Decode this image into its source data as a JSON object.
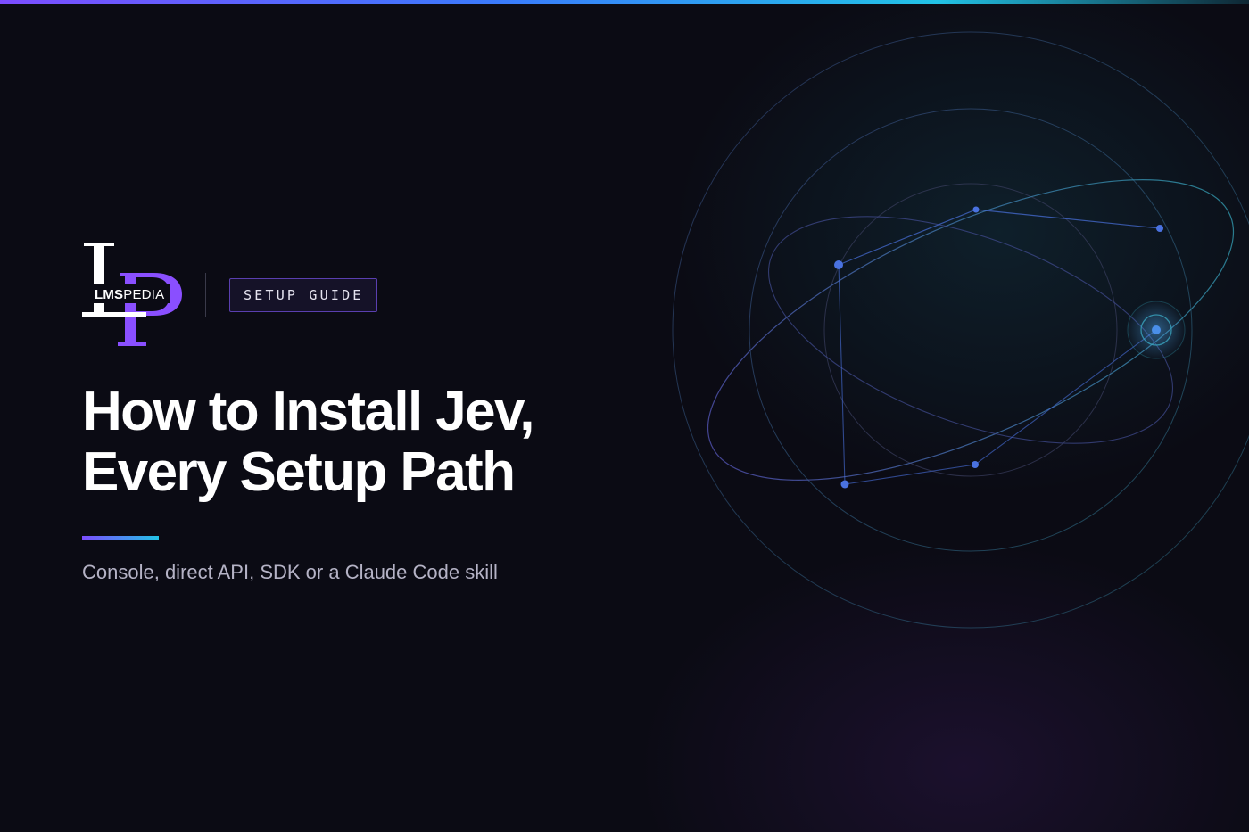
{
  "brand": {
    "logo_letters": "LP",
    "wordmark_bold": "LMS",
    "wordmark_light": "PEDIA"
  },
  "badge": {
    "label": "SETUP GUIDE"
  },
  "hero": {
    "title_line1": "How to Install Jev,",
    "title_line2": "Every Setup Path",
    "subtitle": "Console, direct API, SDK or a Claude Code skill"
  },
  "colors": {
    "background": "#0b0b14",
    "accent_purple": "#7c4dff",
    "accent_cyan": "#22c3e6",
    "node_blue": "#4a72e0"
  },
  "icons": [
    "orbit-network-illustration",
    "lp-logo-icon"
  ]
}
